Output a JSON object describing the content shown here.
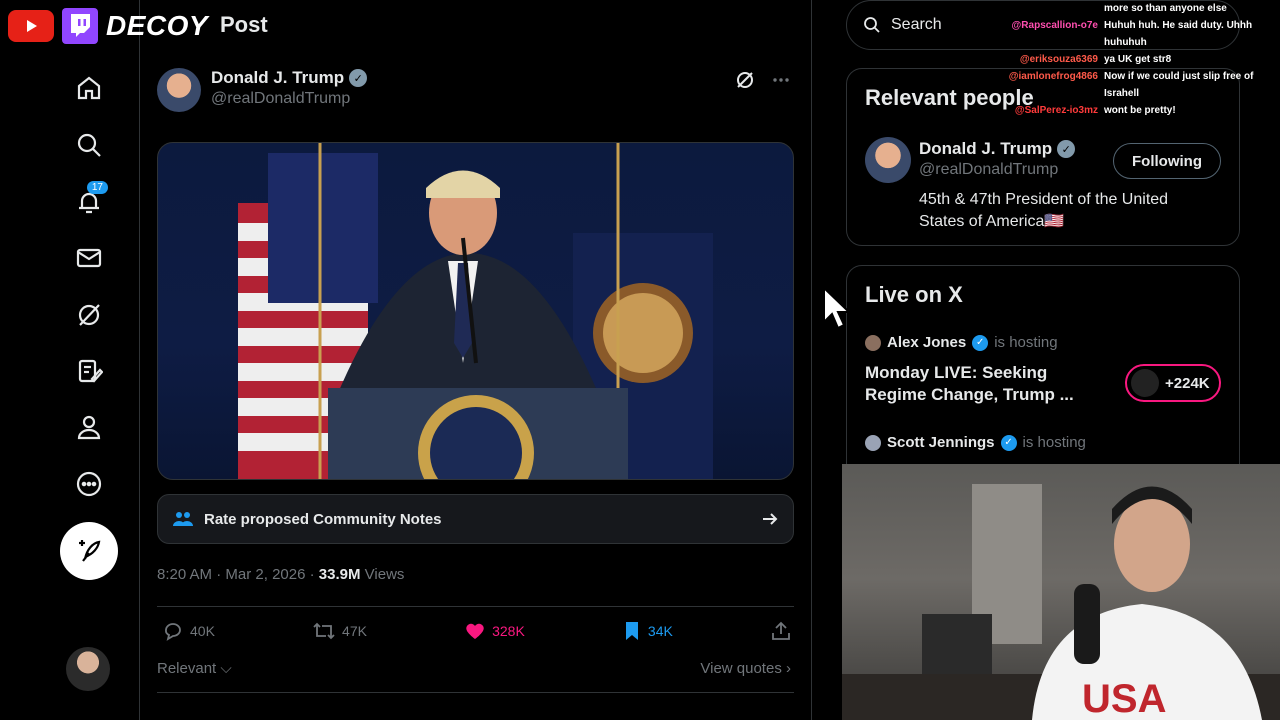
{
  "overlay": {
    "brand": "DECOY"
  },
  "header": {
    "title": "Post"
  },
  "nav": {
    "notifications_badge": "17"
  },
  "post": {
    "author_name": "Donald J. Trump",
    "author_handle": "@realDonaldTrump",
    "community_notes_label": "Rate proposed Community Notes",
    "time": "8:20 AM",
    "date": "Mar 2, 2026",
    "views_count": "33.9M",
    "views_label": "Views",
    "replies": "40K",
    "reposts": "47K",
    "likes": "328K",
    "bookmarks": "34K",
    "sort_label": "Relevant",
    "view_quotes_label": "View quotes"
  },
  "search": {
    "placeholder": "Search"
  },
  "relevant_people": {
    "title": "Relevant people",
    "name": "Donald J. Trump",
    "handle": "@realDonaldTrump",
    "follow_label": "Following",
    "bio": "45th & 47th President of the United States of America🇺🇸"
  },
  "live": {
    "title": "Live on X",
    "host1_name": "Alex Jones",
    "host1_suffix": "is hosting",
    "host1_title": "Monday LIVE: Seeking Regime Change, Trump ...",
    "host1_listeners": "+224K",
    "host2_name": "Scott Jennings",
    "host2_suffix": "is hosting"
  },
  "chat": [
    {
      "user": "",
      "msg": "more so than anyone else",
      "color": "#ffffff"
    },
    {
      "user": "@Rapscallion-o7e",
      "msg": "Huhuh huh. He said duty. Uhhh huhuhuh",
      "color": "#ff4fb0"
    },
    {
      "user": "@eriksouza6369",
      "msg": "ya UK get str8",
      "color": "#ff5a4a"
    },
    {
      "user": "@iamlonefrog4866",
      "msg": "Now if we could just slip free of Israhell",
      "color": "#ff5a4a"
    },
    {
      "user": "@SalPerez-io3mz",
      "msg": "wont be pretty!",
      "color": "#ff3b3b"
    }
  ],
  "colors": {
    "accent": "#1d9bf0",
    "like": "#f91880",
    "muted": "#71767b",
    "text": "#e7e9ea"
  }
}
